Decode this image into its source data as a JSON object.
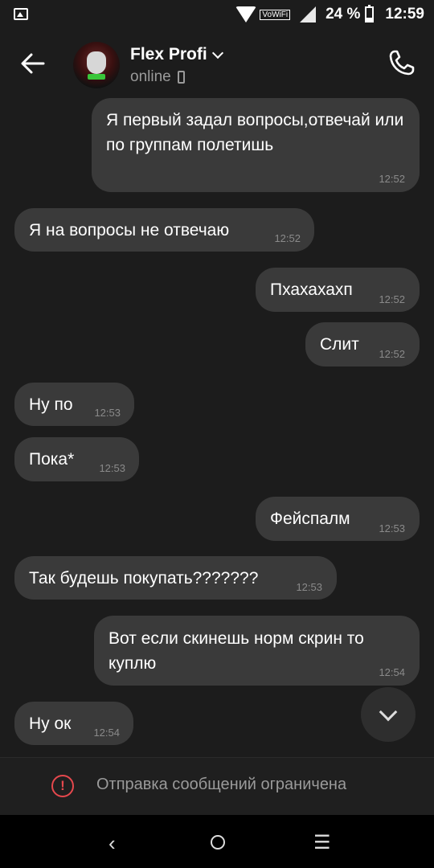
{
  "status_bar": {
    "vowifi": "VoWiFi",
    "battery": "24 %",
    "time": "12:59"
  },
  "header": {
    "contact_name": "Flex Profi",
    "presence": "online"
  },
  "messages": [
    {
      "side": "out",
      "text": "Я первый задал вопросы,отвечай или по группам полетишь",
      "time": "12:52"
    },
    {
      "side": "in",
      "text": "Я на вопросы не отвечаю",
      "time": "12:52"
    },
    {
      "side": "out",
      "text": "Пхахахахп",
      "time": "12:52"
    },
    {
      "side": "out",
      "text": "Слит",
      "time": "12:52"
    },
    {
      "side": "in",
      "text": "Ну по",
      "time": "12:53"
    },
    {
      "side": "in",
      "text": "Пока*",
      "time": "12:53"
    },
    {
      "side": "out",
      "text": "Фейспалм",
      "time": "12:53"
    },
    {
      "side": "in",
      "text": "Так будешь покупать???????",
      "time": "12:53"
    },
    {
      "side": "out",
      "text": "Вот если скинешь норм скрин то куплю",
      "time": "12:54"
    },
    {
      "side": "in",
      "text": "Ну ок",
      "time": "12:54"
    }
  ],
  "restricted": {
    "icon": "!",
    "label": "Отправка сообщений ограничена"
  },
  "navbar": {
    "back": "‹",
    "menu": "☰"
  },
  "icons": {
    "gallery": "gallery-icon",
    "back": "arrow-left-icon",
    "call": "phone-call-icon",
    "scroll": "chevron-down-icon",
    "warning": "warning-icon"
  },
  "colors": {
    "background": "#1c1c1c",
    "bubble": "#3a3a3a",
    "warning": "#e5484d"
  }
}
